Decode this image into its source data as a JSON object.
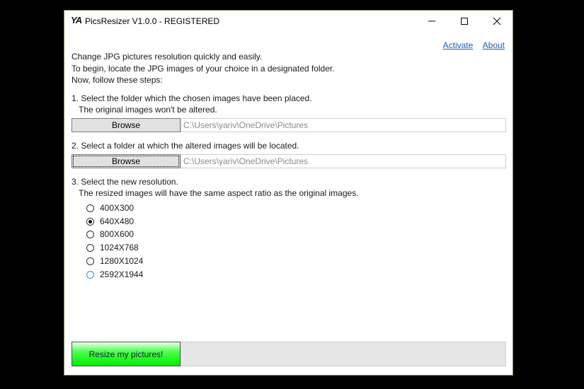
{
  "window": {
    "logo": "YA",
    "title": "PicsResizer V1.0.0 - REGISTERED",
    "controls": {
      "minimize": "minimize",
      "maximize": "maximize",
      "close": "close"
    }
  },
  "links": {
    "activate": "Activate",
    "about": "About"
  },
  "intro": [
    "Change JPG pictures resolution quickly and easily.",
    "To begin, locate the JPG images of your choice in a designated folder.",
    "Now, follow these steps:"
  ],
  "step1": {
    "title": "1. Select the folder which the chosen images have been placed.",
    "note": "The original images won't be altered.",
    "button": "Browse",
    "path": "C:\\Users\\yariv\\OneDrive\\Pictures"
  },
  "step2": {
    "title": "2. Select a folder at which the altered images will be located.",
    "button": "Browse",
    "path": "C:\\Users\\yariv\\OneDrive\\Pictures"
  },
  "step3": {
    "title": "3. Select the new resolution.",
    "note": "The resized images will have the same aspect ratio as the original images.",
    "options": [
      "400X300",
      "640X480",
      "800X600",
      "1024X768",
      "1280X1024",
      "2592X1944"
    ],
    "selected": "640X480"
  },
  "action": {
    "button": "Resize my pictures!",
    "progress_percent": 0
  }
}
